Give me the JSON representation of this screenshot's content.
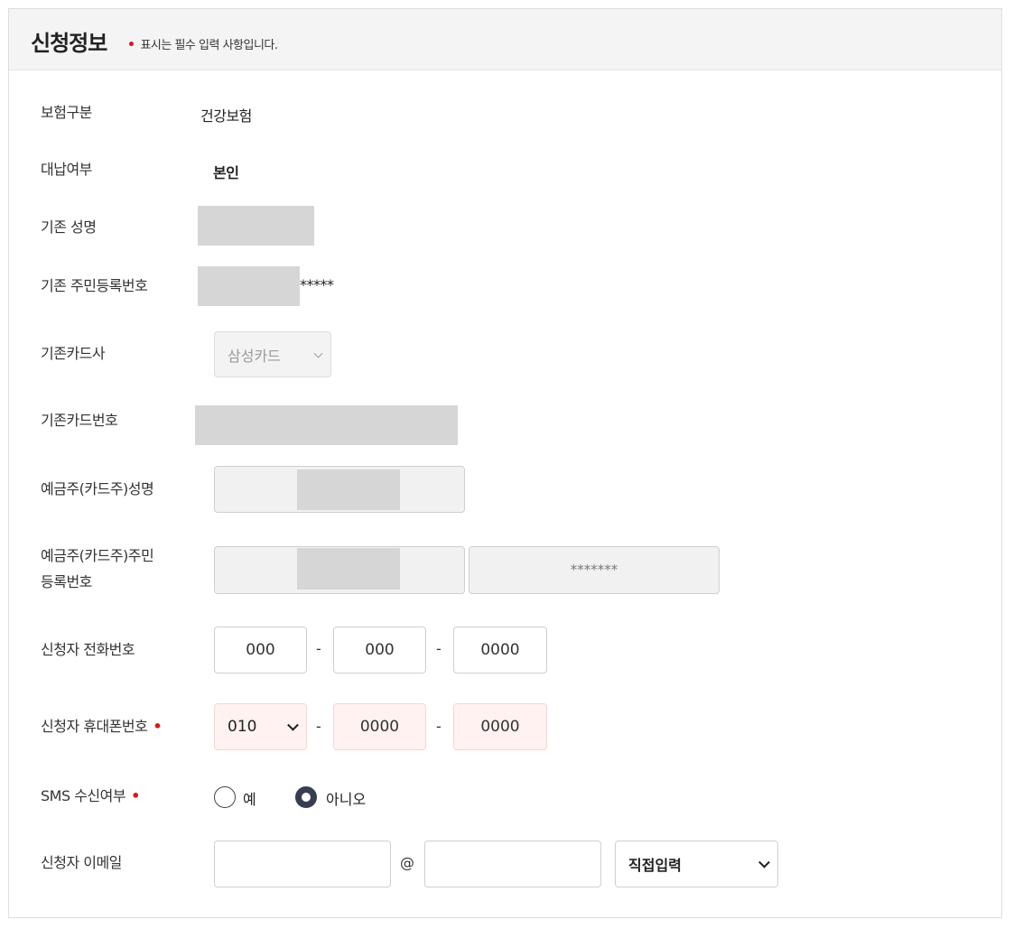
{
  "header": {
    "title": "신청정보",
    "required_mark": "•",
    "note": "표시는 필수 입력 사항입니다."
  },
  "fields": {
    "insurance_type": {
      "label": "보험구분",
      "value": "건강보험"
    },
    "proxy_payment": {
      "label": "대납여부",
      "value": "본인"
    },
    "prev_name": {
      "label": "기존 성명"
    },
    "prev_rrn": {
      "label": "기존 주민등록번호",
      "suffix": "*****"
    },
    "prev_card_company": {
      "label": "기존카드사",
      "selected": "삼성카드"
    },
    "prev_card_number": {
      "label": "기존카드번호"
    },
    "holder_name": {
      "label": "예금주(카드주)성명"
    },
    "holder_rrn": {
      "label_line1": "예금주(카드주)주민",
      "label_line2": "등록번호",
      "back_value": "*******"
    },
    "phone": {
      "label": "신청자 전화번호",
      "part1": "000",
      "part2": "000",
      "part3": "0000",
      "separator": "-"
    },
    "mobile": {
      "label": "신청자 휴대폰번호",
      "prefix": "010",
      "part2": "0000",
      "part3": "0000",
      "separator": "-"
    },
    "sms": {
      "label": "SMS 수신여부",
      "option_yes": "예",
      "option_no": "아니오",
      "selected": "아니오"
    },
    "email": {
      "label": "신청자 이메일",
      "at": "@",
      "domain_select": "직접입력"
    }
  },
  "colors": {
    "required": "#e0141e",
    "highlight_bg": "#fff2f1",
    "radio_checked": "#383e52"
  }
}
